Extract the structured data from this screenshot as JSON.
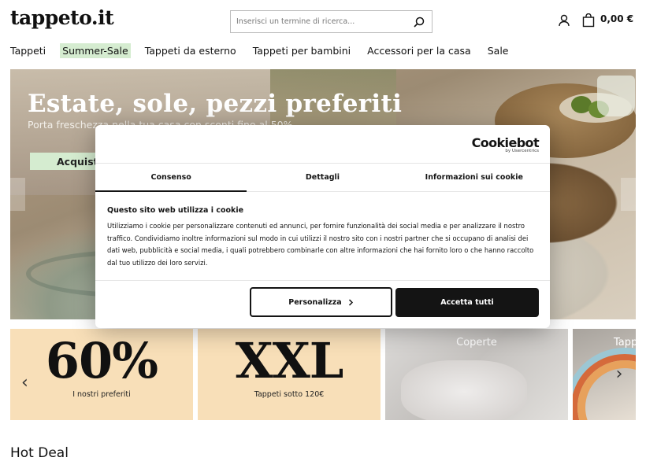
{
  "header": {
    "logo": "tappeto.it",
    "search_placeholder": "Inserisci un termine di ricerca...",
    "cart_total": "0,00 €"
  },
  "nav": {
    "items": [
      "Tappeti",
      "Summer-Sale",
      "Tappeti da esterno",
      "Tappeti per bambini",
      "Accessori per la casa",
      "Sale"
    ],
    "highlight_color": "#d5ecd0"
  },
  "hero": {
    "title": "Estate, sole, pezzi preferiti",
    "subtitle": "Porta freschezza nella tua casa con sconti fino al 50%",
    "cta": "Acquista"
  },
  "tiles": [
    {
      "big": "60%",
      "caption": "I nostri preferiti"
    },
    {
      "big": "XXL",
      "caption": "Tappeti sotto 120€"
    },
    {
      "label": "Coperte"
    },
    {
      "label": "Tappeti"
    }
  ],
  "section_title": "Hot Deal",
  "cookie": {
    "brand": "Cookiebot",
    "brand_sub": "by Usercentrics",
    "tabs": [
      "Consenso",
      "Dettagli",
      "Informazioni sui cookie"
    ],
    "title": "Questo sito web utilizza i cookie",
    "body": "Utilizziamo i cookie per personalizzare contenuti ed annunci, per fornire funzionalità dei social media e per analizzare il nostro traffico. Condividiamo inoltre informazioni sul modo in cui utilizzi il nostro sito con i nostri partner che si occupano di analisi dei dati web, pubblicità e social media, i quali potrebbero combinarle con altre informazioni che hai fornito loro o che hanno raccolto dal tuo utilizzo dei loro servizi.",
    "btn_customize": "Personalizza",
    "btn_accept": "Accetta tutti"
  },
  "icons": [
    "search-icon",
    "user-icon",
    "shopping-bag-icon",
    "chevron-left-icon",
    "chevron-right-icon"
  ]
}
